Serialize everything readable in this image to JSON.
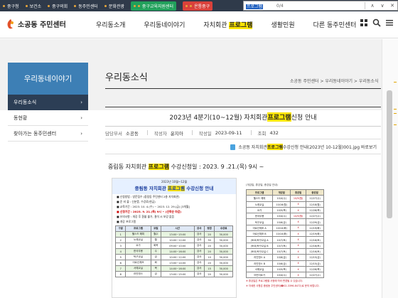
{
  "topbar": {
    "links": [
      "중구청",
      "보건소",
      "중구의회",
      "동주민센터",
      "문화관광"
    ],
    "green_pill": "중구교육지원센터",
    "red_pill": "온통중구"
  },
  "find": {
    "query": "프로그램",
    "count": "0/4"
  },
  "header": {
    "logo_text": "소공동 주민센터",
    "gnb": [
      {
        "label": "우리동소개"
      },
      {
        "label": "우리동네이야기"
      },
      {
        "label_pre": "자치회관 ",
        "label_hl": "프로그램"
      },
      {
        "label": "생활민원"
      },
      {
        "label": "다른 동주민센터"
      }
    ]
  },
  "lnb": {
    "title": "우리동네이야기",
    "items": [
      {
        "label": "우리동소식"
      },
      {
        "label": "동현황"
      },
      {
        "label": "찾아가는 동주민센터"
      }
    ]
  },
  "page": {
    "title": "우리동소식",
    "breadcrumb": "소공동 주민센터 > 우리동네이야기 > 우리동소식"
  },
  "post": {
    "title_pre": "2023년 4분기(10~12월) 자치회관 ",
    "title_hl": "프로그램",
    "title_post": " 신청 안내",
    "meta": {
      "author_label": "담당부서",
      "author": "소공동",
      "writer_label": "작성자",
      "writer": "윤지아",
      "date_label": "작성일",
      "date": "2023-09-11",
      "views_label": "조회",
      "views": "432"
    },
    "attachment_pre": "소공동 자치회관 ",
    "attachment_hl": "프로그램",
    "attachment_post": " 수강신청 안내(2023년 10-12월)001.jpg 바로보기",
    "lead_pre": "중림동 자치회관 ",
    "lead_hl": "프로그램",
    "lead_post": " 수강신청일 : 2023. 9 .21.(목) 9시 ~"
  },
  "poster": {
    "header_small": "2023년 10월~12월",
    "header_pre": "중림동 자치회관 ",
    "header_hl": "프로그램",
    "header_post": " 수강신청 안내",
    "lines": [
      "■ 신청방법 : 방문접수 (중림동 주민센터 2층 자치회관)",
      "■ 준 비 물 : 신분증, 수강료(현금)",
      "■ 교육기간 : 2023. 10. 4.(수) ~ 2023. 12. 29.(금) [3개월]",
      "■ 신청기간 : 2023. 9. 21.(목) 9시 ~ (선착순 마감)",
      "■ 유의사항 : 개강 후 환불 불가, 결석 시 보강 없음",
      "■ 개강 프로그램"
    ],
    "table_head": [
      "구분",
      "프로그램",
      "요일",
      "시간",
      "강사",
      "정원",
      "수강료"
    ],
    "rows": [
      [
        "1",
        "헬스드 해피",
        "월수",
        "13:00~15:00",
        "강사",
        "20",
        "30,000"
      ],
      [
        "2",
        "노래교실",
        "월",
        "10:00~12:00",
        "강사",
        "30",
        "30,000"
      ],
      [
        "3",
        "요가",
        "화목",
        "09:00~10:00",
        "강사",
        "20",
        "30,000"
      ],
      [
        "4",
        "한국무용",
        "수",
        "14:00~16:00",
        "강사",
        "20",
        "30,000"
      ],
      [
        "5",
        "탁구교실",
        "금",
        "10:00~12:00",
        "강사",
        "10",
        "30,000"
      ],
      [
        "6",
        "어르신체조",
        "화",
        "13:00~14:00",
        "강사",
        "20",
        "30,000"
      ],
      [
        "7",
        "서예교실",
        "목",
        "14:00~16:00",
        "강사",
        "15",
        "30,000"
      ],
      [
        "8",
        "라인댄스",
        "금",
        "13:00~15:00",
        "강사",
        "20",
        "30,000"
      ]
    ]
  },
  "schedule": {
    "heading": "(개강일, 휴강일, 종강일 안내)",
    "head": [
      "프로그램",
      "개강일",
      "휴강일",
      "종강일"
    ],
    "rows": [
      [
        "헬스드 해피",
        "10/4(수)",
        "10/9(월)",
        "12/27(수)"
      ],
      [
        "노래교실",
        "10/16(월)",
        "X",
        "12/18(월)"
      ],
      [
        "요가",
        "10/5(목)",
        "X",
        "12/28(목)"
      ],
      [
        "한국무용",
        "10/4(수)",
        "10/9(월)",
        "12/27(수)"
      ],
      [
        "탁구교실",
        "10/6(금)",
        "X",
        "12/29(금)"
      ],
      [
        "어르신체조 A",
        "10/10(화)",
        "X",
        "12/19(화)"
      ],
      [
        "어르신체조 B",
        "10/10(화)",
        "X",
        "12/19(화)"
      ],
      [
        "(토요)탁구교실 A",
        "10/7(토)",
        "X",
        "12/16(토)"
      ],
      [
        "(토요)탁구교실 B",
        "10/7(토)",
        "X",
        "12/16(토)"
      ],
      [
        "(토요)탁구교실 C",
        "10/7(토)",
        "X",
        "12/16(토)"
      ],
      [
        "라인댄스 A",
        "10/6(금)",
        "X",
        "12/15(금)"
      ],
      [
        "라인댄스 B",
        "10/6(금)",
        "X",
        "12/15(금)"
      ],
      [
        "서예교실",
        "10/5(목)",
        "X",
        "12/28(목)"
      ],
      [
        "어린이요가",
        "10/4(수)",
        "X",
        "12/27(수)"
      ]
    ],
    "notes": [
      "※ 휴강일은 프로그램별 사정에 따라 변경될 수 있습니다.",
      "※ 자세한 사항은 중림동 주민센터(☎02-3396-8472)로 문의 바랍니다."
    ]
  },
  "colors": {
    "topbar": "#2f3a4a",
    "lnb_title": "#3d7fb5",
    "lnb_active": "#2c3e55",
    "highlight": "#ffe600"
  }
}
